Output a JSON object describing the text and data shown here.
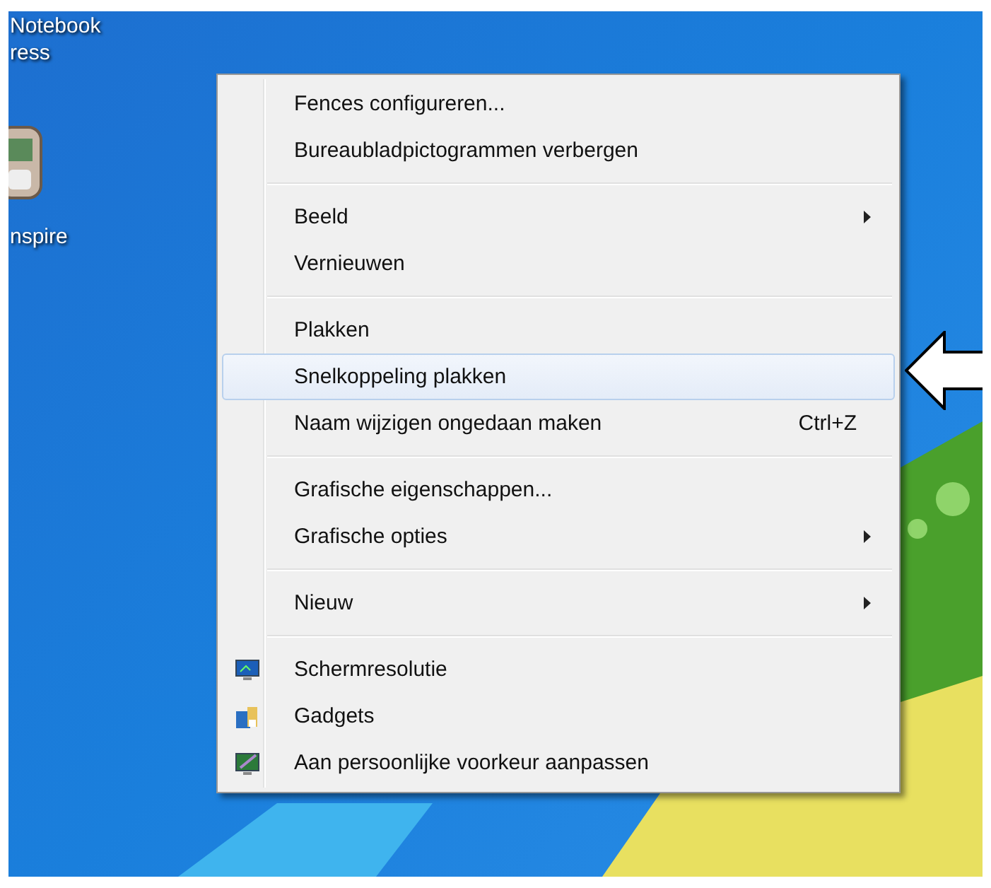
{
  "desktop_icons": [
    {
      "label_lines": [
        "Notebook",
        "ress"
      ]
    },
    {
      "label_lines": [
        "nspire"
      ]
    }
  ],
  "context_menu": {
    "groups": [
      {
        "items": [
          {
            "label": "Fences configureren...",
            "submenu": false,
            "selected": false
          },
          {
            "label": "Bureaubladpictogrammen verbergen",
            "submenu": false,
            "selected": false
          }
        ]
      },
      {
        "items": [
          {
            "label": "Beeld",
            "submenu": true,
            "selected": false
          },
          {
            "label": "Vernieuwen",
            "submenu": false,
            "selected": false
          }
        ]
      },
      {
        "items": [
          {
            "label": "Plakken",
            "submenu": false,
            "selected": false
          },
          {
            "label": "Snelkoppeling plakken",
            "submenu": false,
            "selected": true
          },
          {
            "label": "Naam wijzigen ongedaan maken",
            "shortcut": "Ctrl+Z",
            "submenu": false,
            "selected": false
          }
        ]
      },
      {
        "items": [
          {
            "label": "Grafische eigenschappen...",
            "submenu": false,
            "selected": false
          },
          {
            "label": "Grafische opties",
            "submenu": true,
            "selected": false
          }
        ]
      },
      {
        "items": [
          {
            "label": "Nieuw",
            "submenu": true,
            "selected": false
          }
        ]
      },
      {
        "items": [
          {
            "label": "Schermresolutie",
            "submenu": false,
            "selected": false
          },
          {
            "label": "Gadgets",
            "submenu": false,
            "selected": false
          },
          {
            "label": "Aan persoonlijke voorkeur aanpassen",
            "submenu": false,
            "selected": false
          }
        ]
      }
    ]
  }
}
